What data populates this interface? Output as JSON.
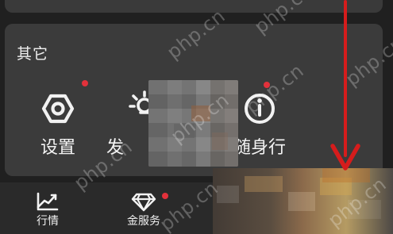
{
  "section": {
    "title": "其它"
  },
  "menu": {
    "items": [
      {
        "label": "设置"
      },
      {
        "label": "发"
      },
      {
        "label": "随身行"
      }
    ]
  },
  "tabs": [
    {
      "label": "行情"
    },
    {
      "label": "金服务"
    }
  ],
  "watermark": {
    "text": "php.cn"
  },
  "icons": {
    "settings": "hexagon-gear-icon",
    "fahuo": "sun-lightbulb-icon",
    "travel": "info-circle-icon",
    "quotes": "trend-chart-icon",
    "gold": "diamond-icon"
  },
  "colors": {
    "accent_red": "#d61c1c",
    "dot_red": "#e2313b"
  }
}
